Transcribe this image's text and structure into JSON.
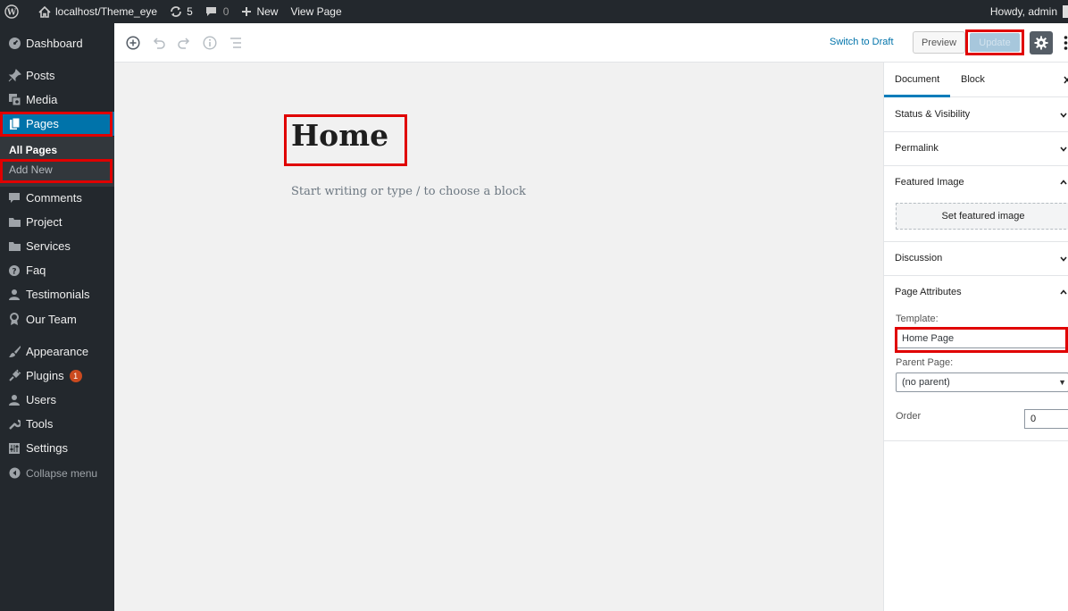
{
  "adminbar": {
    "site_name": "localhost/Theme_eye",
    "updates_count": "5",
    "comments_count": "0",
    "new_label": "New",
    "view_page_label": "View Page",
    "howdy": "Howdy, admin"
  },
  "sidebar": {
    "dashboard": "Dashboard",
    "posts": "Posts",
    "media": "Media",
    "pages": "Pages",
    "all_pages": "All Pages",
    "add_new": "Add New",
    "comments": "Comments",
    "project": "Project",
    "services": "Services",
    "faq": "Faq",
    "testimonials": "Testimonials",
    "our_team": "Our Team",
    "appearance": "Appearance",
    "plugins": "Plugins",
    "plugins_badge": "1",
    "users": "Users",
    "tools": "Tools",
    "settings": "Settings",
    "collapse": "Collapse menu"
  },
  "toolbar": {
    "switch_to_draft": "Switch to Draft",
    "preview": "Preview",
    "update": "Update"
  },
  "editor": {
    "title": "Home",
    "placeholder": "Start writing or type / to choose a block"
  },
  "panel": {
    "tab_document": "Document",
    "tab_block": "Block",
    "status_visibility": "Status & Visibility",
    "permalink": "Permalink",
    "featured_image": "Featured Image",
    "set_featured_image": "Set featured image",
    "discussion": "Discussion",
    "page_attributes": "Page Attributes",
    "template_label": "Template:",
    "template_value": "Home Page",
    "parent_label": "Parent Page:",
    "parent_value": "(no parent)",
    "order_label": "Order",
    "order_value": "0"
  },
  "colors": {
    "adminbar_bg": "#23282d",
    "accent": "#0073aa",
    "highlight": "#e00000"
  }
}
